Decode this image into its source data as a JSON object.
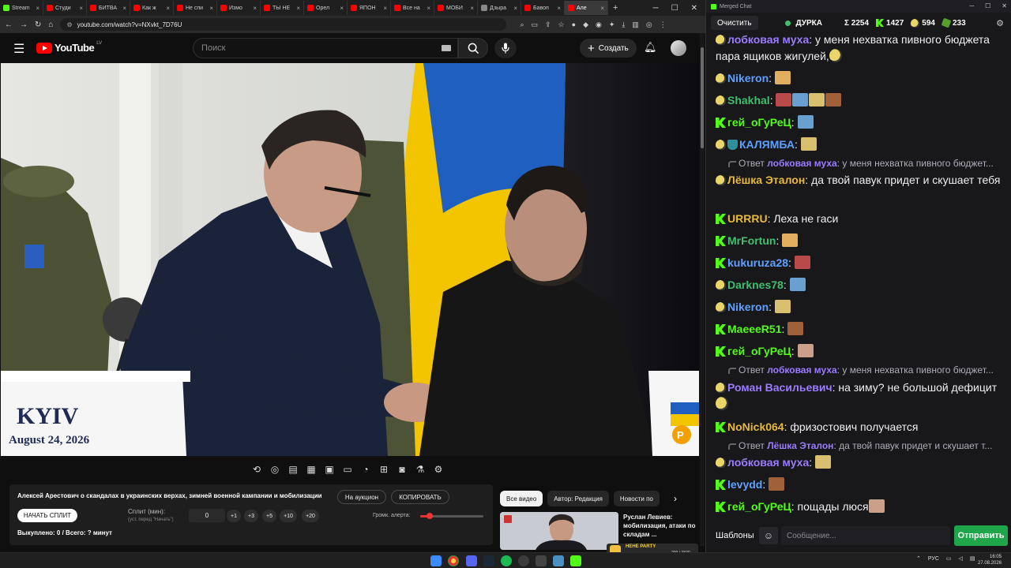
{
  "browser": {
    "tabs": [
      {
        "label": "Stream",
        "color": "#53fc18"
      },
      {
        "label": "Студи",
        "color": "#ff0000"
      },
      {
        "label": "БИТВА",
        "color": "#ff0000"
      },
      {
        "label": "Как ж",
        "color": "#ff0000"
      },
      {
        "label": "Не спи",
        "color": "#ff0000"
      },
      {
        "label": "Измо",
        "color": "#ff0000"
      },
      {
        "label": "ТЫ НЕ",
        "color": "#ff0000"
      },
      {
        "label": "Орел",
        "color": "#ff0000"
      },
      {
        "label": "ЯПОН",
        "color": "#ff0000"
      },
      {
        "label": "Все на",
        "color": "#ff0000"
      },
      {
        "label": "МОБИ",
        "color": "#ff0000"
      },
      {
        "label": "Дзыра",
        "color": "#888888"
      },
      {
        "label": "Бавоп",
        "color": "#ff0000"
      },
      {
        "label": "Але",
        "color": "#ff0000"
      }
    ],
    "url": "youtube.com/watch?v=NXvkt_7D76U"
  },
  "youtube": {
    "logo_text": "YouTube",
    "country_code": "LV",
    "search_placeholder": "Поиск",
    "create_label": "Создать"
  },
  "video": {
    "podium_city": "KYIV",
    "podium_date": "August 24, 2026",
    "right_podium_logo": "P"
  },
  "extension": {
    "title": "Алексей Арестович о скандалах в украинских верхах, зимней военной кампании и мобилизации",
    "auction_label": "На аукцион",
    "copy_label": "КОПИРОВАТЬ",
    "start_split_label": "НАЧАТЬ СПЛИТ",
    "split_label": "Сплит (мин):",
    "split_hint": "(уст. перед \"Начать\")",
    "split_value": "0",
    "increments": [
      "+1",
      "+3",
      "+5",
      "+10",
      "+20"
    ],
    "alert_label": "Громк. алерта:",
    "alert_volume": 0.15,
    "bought_text": "Выкуплено: 0 / Всего: ? минут"
  },
  "related": {
    "chips": [
      "Все видео",
      "Автор: Редакция",
      "Новости по"
    ],
    "video_title": "Руслан Левиев: мобилизация, атаки по складам ...",
    "overlay_label": "НЕНЕ PARTY",
    "overlay_count": "200 / 1500"
  },
  "chat": {
    "window_title": "Merged Chat",
    "clear_label": "Очистить",
    "channel_name": "ДУРКА",
    "total_viewers": "Σ 2254",
    "kick_viewers": "1427",
    "twitch_viewers": "594",
    "other_viewers": "233",
    "templates_label": "Шаблоны",
    "input_placeholder": "Сообщение...",
    "send_label": "Отправить",
    "messages": [
      {
        "platform": "twitch",
        "user": "лобковая муха",
        "color": "#9b7bff",
        "text": "у меня нехватка пивного бюджета пара ящиков жигулей,"
      },
      {
        "platform": "twitch",
        "user": "Nikeron",
        "color": "#5ea0ff",
        "text": ""
      },
      {
        "platform": "twitch",
        "user": "Shakhal",
        "color": "#3fbf6f",
        "text": ""
      },
      {
        "platform": "kick",
        "user": "гей_оГуРеЦ",
        "color": "#53fc18",
        "text": ""
      },
      {
        "platform": "twitch",
        "user": "КАЛЯМБА",
        "color": "#5ea0ff",
        "text": ""
      },
      {
        "reply_user": "лобковая муха",
        "reply_text": "у меня нехватка пивного бюджет..."
      },
      {
        "platform": "twitch",
        "user": "Лёшка Эталон",
        "color": "#e8b93a",
        "text": "да твой павук придет и скушает тебя"
      },
      {
        "platform": "kick",
        "user": "URRRU",
        "color": "#e8b93a",
        "text": "Леха не гаси"
      },
      {
        "platform": "kick",
        "user": "MrFortun",
        "color": "#3fbf6f",
        "text": ""
      },
      {
        "platform": "kick",
        "user": "kukuruza28",
        "color": "#5ea0ff",
        "text": ""
      },
      {
        "platform": "twitch",
        "user": "Darknes78",
        "color": "#3fbf6f",
        "text": ""
      },
      {
        "platform": "twitch",
        "user": "Nikeron",
        "color": "#5ea0ff",
        "text": ""
      },
      {
        "platform": "kick",
        "user": "MaeeeR51",
        "color": "#53fc18",
        "text": ""
      },
      {
        "platform": "kick",
        "user": "гей_оГуРеЦ",
        "color": "#53fc18",
        "text": ""
      },
      {
        "reply_user": "лобковая муха",
        "reply_text": "у меня нехватка пивного бюджет..."
      },
      {
        "platform": "twitch",
        "user": "Роман Васильевич",
        "color": "#9b7bff",
        "text": "на зиму? не большой дефицит"
      },
      {
        "platform": "kick",
        "user": "NoNick064",
        "color": "#e8b93a",
        "text": "фризостович получается"
      },
      {
        "reply_user": "Лёшка Эталон",
        "reply_text": "да твой павук придет и скушает т..."
      },
      {
        "platform": "twitch",
        "user": "лобковая муха",
        "color": "#9b7bff",
        "text": ""
      },
      {
        "platform": "kick",
        "user": "levydd",
        "color": "#5ea0ff",
        "text": ""
      },
      {
        "platform": "kick",
        "user": "гей_оГуРеЦ",
        "color": "#53fc18",
        "text": "пощады люся"
      }
    ]
  },
  "taskbar": {
    "lang": "РУС",
    "time": "16:05",
    "date": "27.08.2026"
  }
}
